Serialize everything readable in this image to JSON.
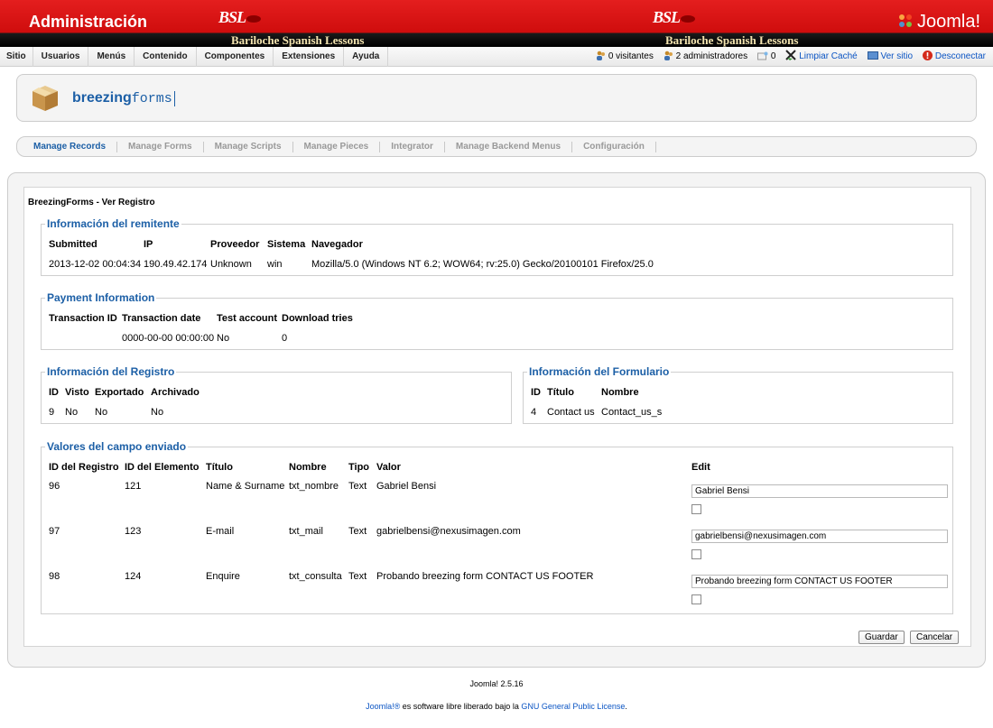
{
  "header": {
    "admin_title": "Administración",
    "site_logo_text": "BSL",
    "site_name": "Bariloche Spanish Lessons",
    "joomla_logo": "Joomla!"
  },
  "menubar": {
    "items": [
      "Sitio",
      "Usuarios",
      "Menús",
      "Contenido",
      "Componentes",
      "Extensiones",
      "Ayuda"
    ],
    "status": {
      "visitors": "0 visitantes",
      "admins": "2 administradores",
      "messages": "0",
      "clear_cache": "Limpiar Caché",
      "view_site": "Ver sitio",
      "logout": "Desconectar"
    }
  },
  "logo": {
    "brand_bold": "breezing",
    "brand_light": "forms"
  },
  "tabs": [
    "Manage Records",
    "Manage Forms",
    "Manage Scripts",
    "Manage Pieces",
    "Integrator",
    "Manage Backend Menus",
    "Configuración"
  ],
  "page_title": "BreezingForms - Ver Registro",
  "sender": {
    "legend": "Información del remitente",
    "headers": [
      "Submitted",
      "IP",
      "Proveedor",
      "Sistema",
      "Navegador"
    ],
    "values": [
      "2013-12-02 00:04:34",
      "190.49.42.174",
      "Unknown",
      "win",
      "Mozilla/5.0 (Windows NT 6.2; WOW64; rv:25.0) Gecko/20100101 Firefox/25.0"
    ]
  },
  "payment": {
    "legend": "Payment Information",
    "headers": [
      "Transaction ID",
      "Transaction date",
      "Test account",
      "Download tries"
    ],
    "values": [
      "",
      "0000-00-00 00:00:00",
      "No",
      "0"
    ]
  },
  "record": {
    "legend": "Información del Registro",
    "headers": [
      "ID",
      "Visto",
      "Exportado",
      "Archivado"
    ],
    "values": [
      "9",
      "No",
      "No",
      "No"
    ]
  },
  "form": {
    "legend": "Información del Formulario",
    "headers": [
      "ID",
      "Título",
      "Nombre"
    ],
    "values": [
      "4",
      "Contact us",
      "Contact_us_s"
    ]
  },
  "fields": {
    "legend": "Valores del campo enviado",
    "headers": [
      "ID del Registro",
      "ID del Elemento",
      "Título",
      "Nombre",
      "Tipo",
      "Valor",
      "Edit"
    ],
    "rows": [
      {
        "record_id": "96",
        "element_id": "121",
        "title": "Name & Surname",
        "name": "txt_nombre",
        "type": "Text",
        "value": "Gabriel Bensi",
        "edit": "Gabriel Bensi"
      },
      {
        "record_id": "97",
        "element_id": "123",
        "title": "E-mail",
        "name": "txt_mail",
        "type": "Text",
        "value": "gabrielbensi@nexusimagen.com",
        "edit": "gabrielbensi@nexusimagen.com"
      },
      {
        "record_id": "98",
        "element_id": "124",
        "title": "Enquire",
        "name": "txt_consulta",
        "type": "Text",
        "value": "Probando breezing form CONTACT US FOOTER",
        "edit": "Probando breezing form CONTACT US FOOTER"
      }
    ]
  },
  "buttons": {
    "save": "Guardar",
    "cancel": "Cancelar"
  },
  "footer": {
    "version": "Joomla! 2.5.16",
    "license_link1": "Joomla!®",
    "license_text": " es software libre liberado bajo la ",
    "license_link2": "GNU General Public License",
    "license_end": "."
  }
}
